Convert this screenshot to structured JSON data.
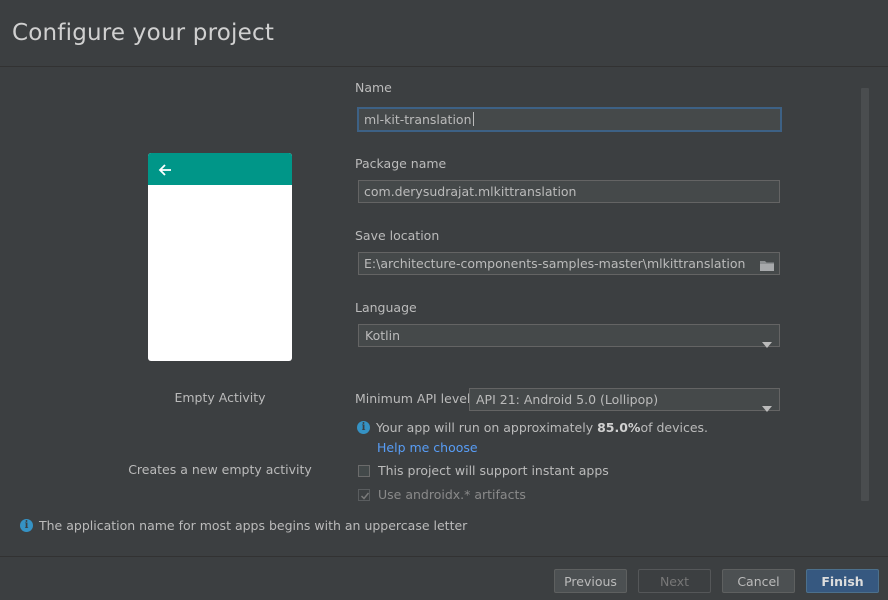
{
  "header": {
    "title": "Configure your project"
  },
  "preview": {
    "activity_name": "Empty Activity",
    "activity_description": "Creates a new empty activity",
    "toolbar_color": "#009688"
  },
  "form": {
    "name_label": "Name",
    "name_value": "ml-kit-translation",
    "package_label": "Package name",
    "package_value": "com.derysudrajat.mlkittranslation",
    "save_label": "Save location",
    "save_value": "E:\\architecture-components-samples-master\\mlkittranslation",
    "language_label": "Language",
    "language_value": "Kotlin",
    "min_api_label": "Minimum API level",
    "min_api_value": "API 21: Android 5.0 (Lollipop)",
    "info_prefix": "Your app will run on approximately ",
    "info_percent": "85.0%",
    "info_suffix": " of devices.",
    "help_link": "Help me choose",
    "instant_apps_label": "This project will support instant apps",
    "androidx_label": "Use androidx.* artifacts"
  },
  "status": {
    "message": "The application name for most apps begins with an uppercase letter"
  },
  "footer": {
    "previous": "Previous",
    "next": "Next",
    "cancel": "Cancel",
    "finish": "Finish"
  },
  "colors": {
    "accent": "#365880",
    "link": "#589df6",
    "info": "#3592c4"
  }
}
